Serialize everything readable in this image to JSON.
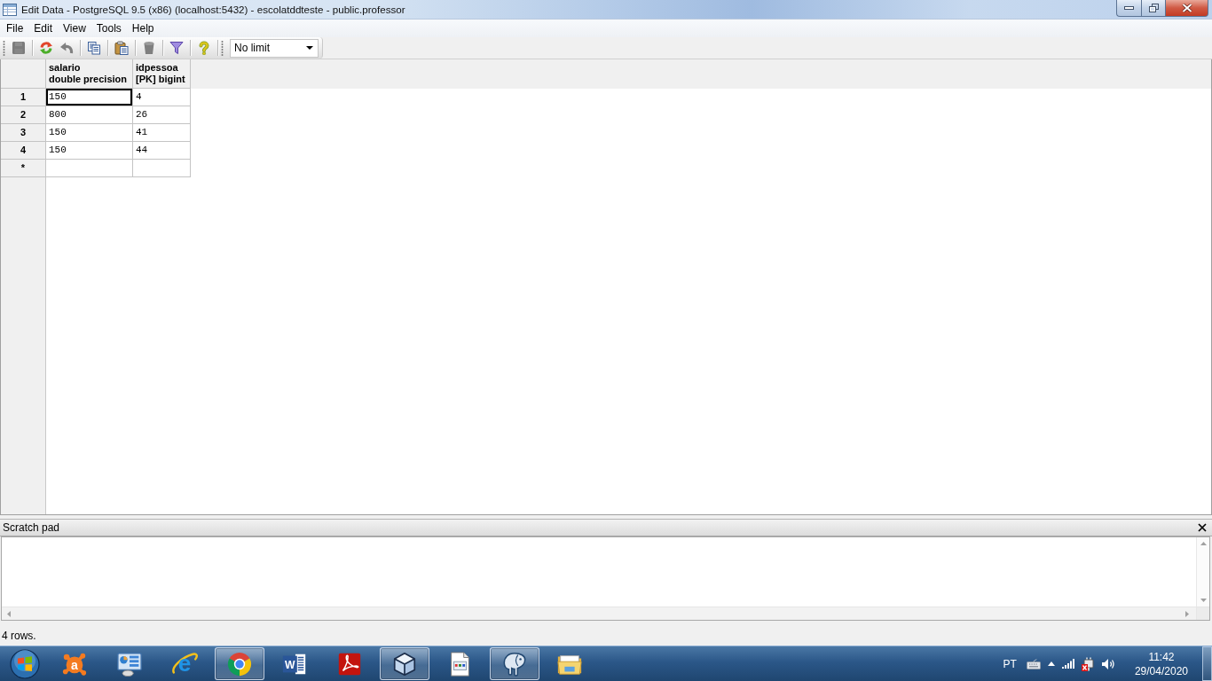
{
  "window": {
    "title": "Edit Data - PostgreSQL 9.5 (x86) (localhost:5432) - escolatddteste - public.professor"
  },
  "menu": [
    {
      "label": "File"
    },
    {
      "label": "Edit"
    },
    {
      "label": "View"
    },
    {
      "label": "Tools"
    },
    {
      "label": "Help"
    }
  ],
  "toolbar": {
    "groups": [
      {
        "buttons": [
          {
            "kind": "save",
            "disabled": true
          }
        ]
      },
      {
        "buttons": [
          {
            "kind": "refresh",
            "disabled": false
          },
          {
            "kind": "undo",
            "disabled": true
          }
        ]
      },
      {
        "buttons": [
          {
            "kind": "copy",
            "disabled": false
          }
        ]
      },
      {
        "buttons": [
          {
            "kind": "paste",
            "disabled": false
          }
        ]
      },
      {
        "buttons": [
          {
            "kind": "delete",
            "disabled": true
          }
        ]
      },
      {
        "buttons": [
          {
            "kind": "filter",
            "disabled": false
          }
        ]
      },
      {
        "buttons": [
          {
            "kind": "help",
            "disabled": false
          }
        ]
      }
    ],
    "row_limit": {
      "value": "No limit"
    }
  },
  "grid": {
    "columns": [
      {
        "name": "salario",
        "type": "double precision"
      },
      {
        "name": "idpessoa",
        "type": "[PK] bigint"
      }
    ],
    "rows": [
      {
        "number": "1",
        "cells": [
          {
            "value": "150",
            "selected": true
          },
          {
            "value": "4",
            "selected": false
          }
        ]
      },
      {
        "number": "2",
        "cells": [
          {
            "value": "800",
            "selected": false
          },
          {
            "value": "26",
            "selected": false
          }
        ]
      },
      {
        "number": "3",
        "cells": [
          {
            "value": "150",
            "selected": false
          },
          {
            "value": "41",
            "selected": false
          }
        ]
      },
      {
        "number": "4",
        "cells": [
          {
            "value": "150",
            "selected": false
          },
          {
            "value": "44",
            "selected": false
          }
        ]
      }
    ],
    "new_row": {
      "marker": "*"
    }
  },
  "scratch_pad": {
    "title": "Scratch pad"
  },
  "status_bar": {
    "text": "4 rows."
  },
  "taskbar": {
    "apps": [
      {
        "kind": "antivirus",
        "glyph": "a",
        "running": false
      },
      {
        "kind": "control_panel",
        "running": false
      },
      {
        "kind": "ie",
        "glyph": "e",
        "running": false
      },
      {
        "kind": "chrome",
        "running": true
      },
      {
        "kind": "word",
        "glyph": "W",
        "running": false
      },
      {
        "kind": "pdf",
        "running": false
      },
      {
        "kind": "cube",
        "running": true
      },
      {
        "kind": "document",
        "running": false
      },
      {
        "kind": "elephant",
        "running": true
      },
      {
        "kind": "folder",
        "running": false
      }
    ],
    "tray": {
      "language": "PT",
      "time": "11:42",
      "date": "29/04/2020"
    }
  }
}
